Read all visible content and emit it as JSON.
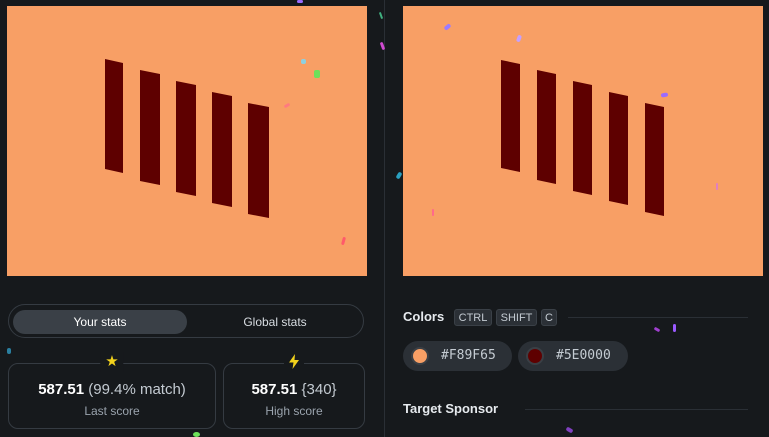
{
  "target_image": {
    "background": "#F89F65",
    "bar_color": "#5E0000"
  },
  "stats_toggle": {
    "active_label": "Your stats",
    "inactive_label": "Global stats"
  },
  "last_score": {
    "icon": "star-icon",
    "value": "587.51",
    "match": "(99.4% match)",
    "label": "Last score"
  },
  "high_score": {
    "icon": "lightning-icon",
    "value": "587.51",
    "rank": "{340}",
    "label": "High score"
  },
  "colors_section": {
    "title": "Colors",
    "shortcut_keys": [
      "CTRL",
      "SHIFT",
      "C"
    ],
    "swatches": [
      {
        "hex": "#F89F65",
        "color": "#F89F65"
      },
      {
        "hex": "#5E0000",
        "color": "#5E0000"
      }
    ]
  },
  "sponsor_section": {
    "title": "Target Sponsor"
  }
}
